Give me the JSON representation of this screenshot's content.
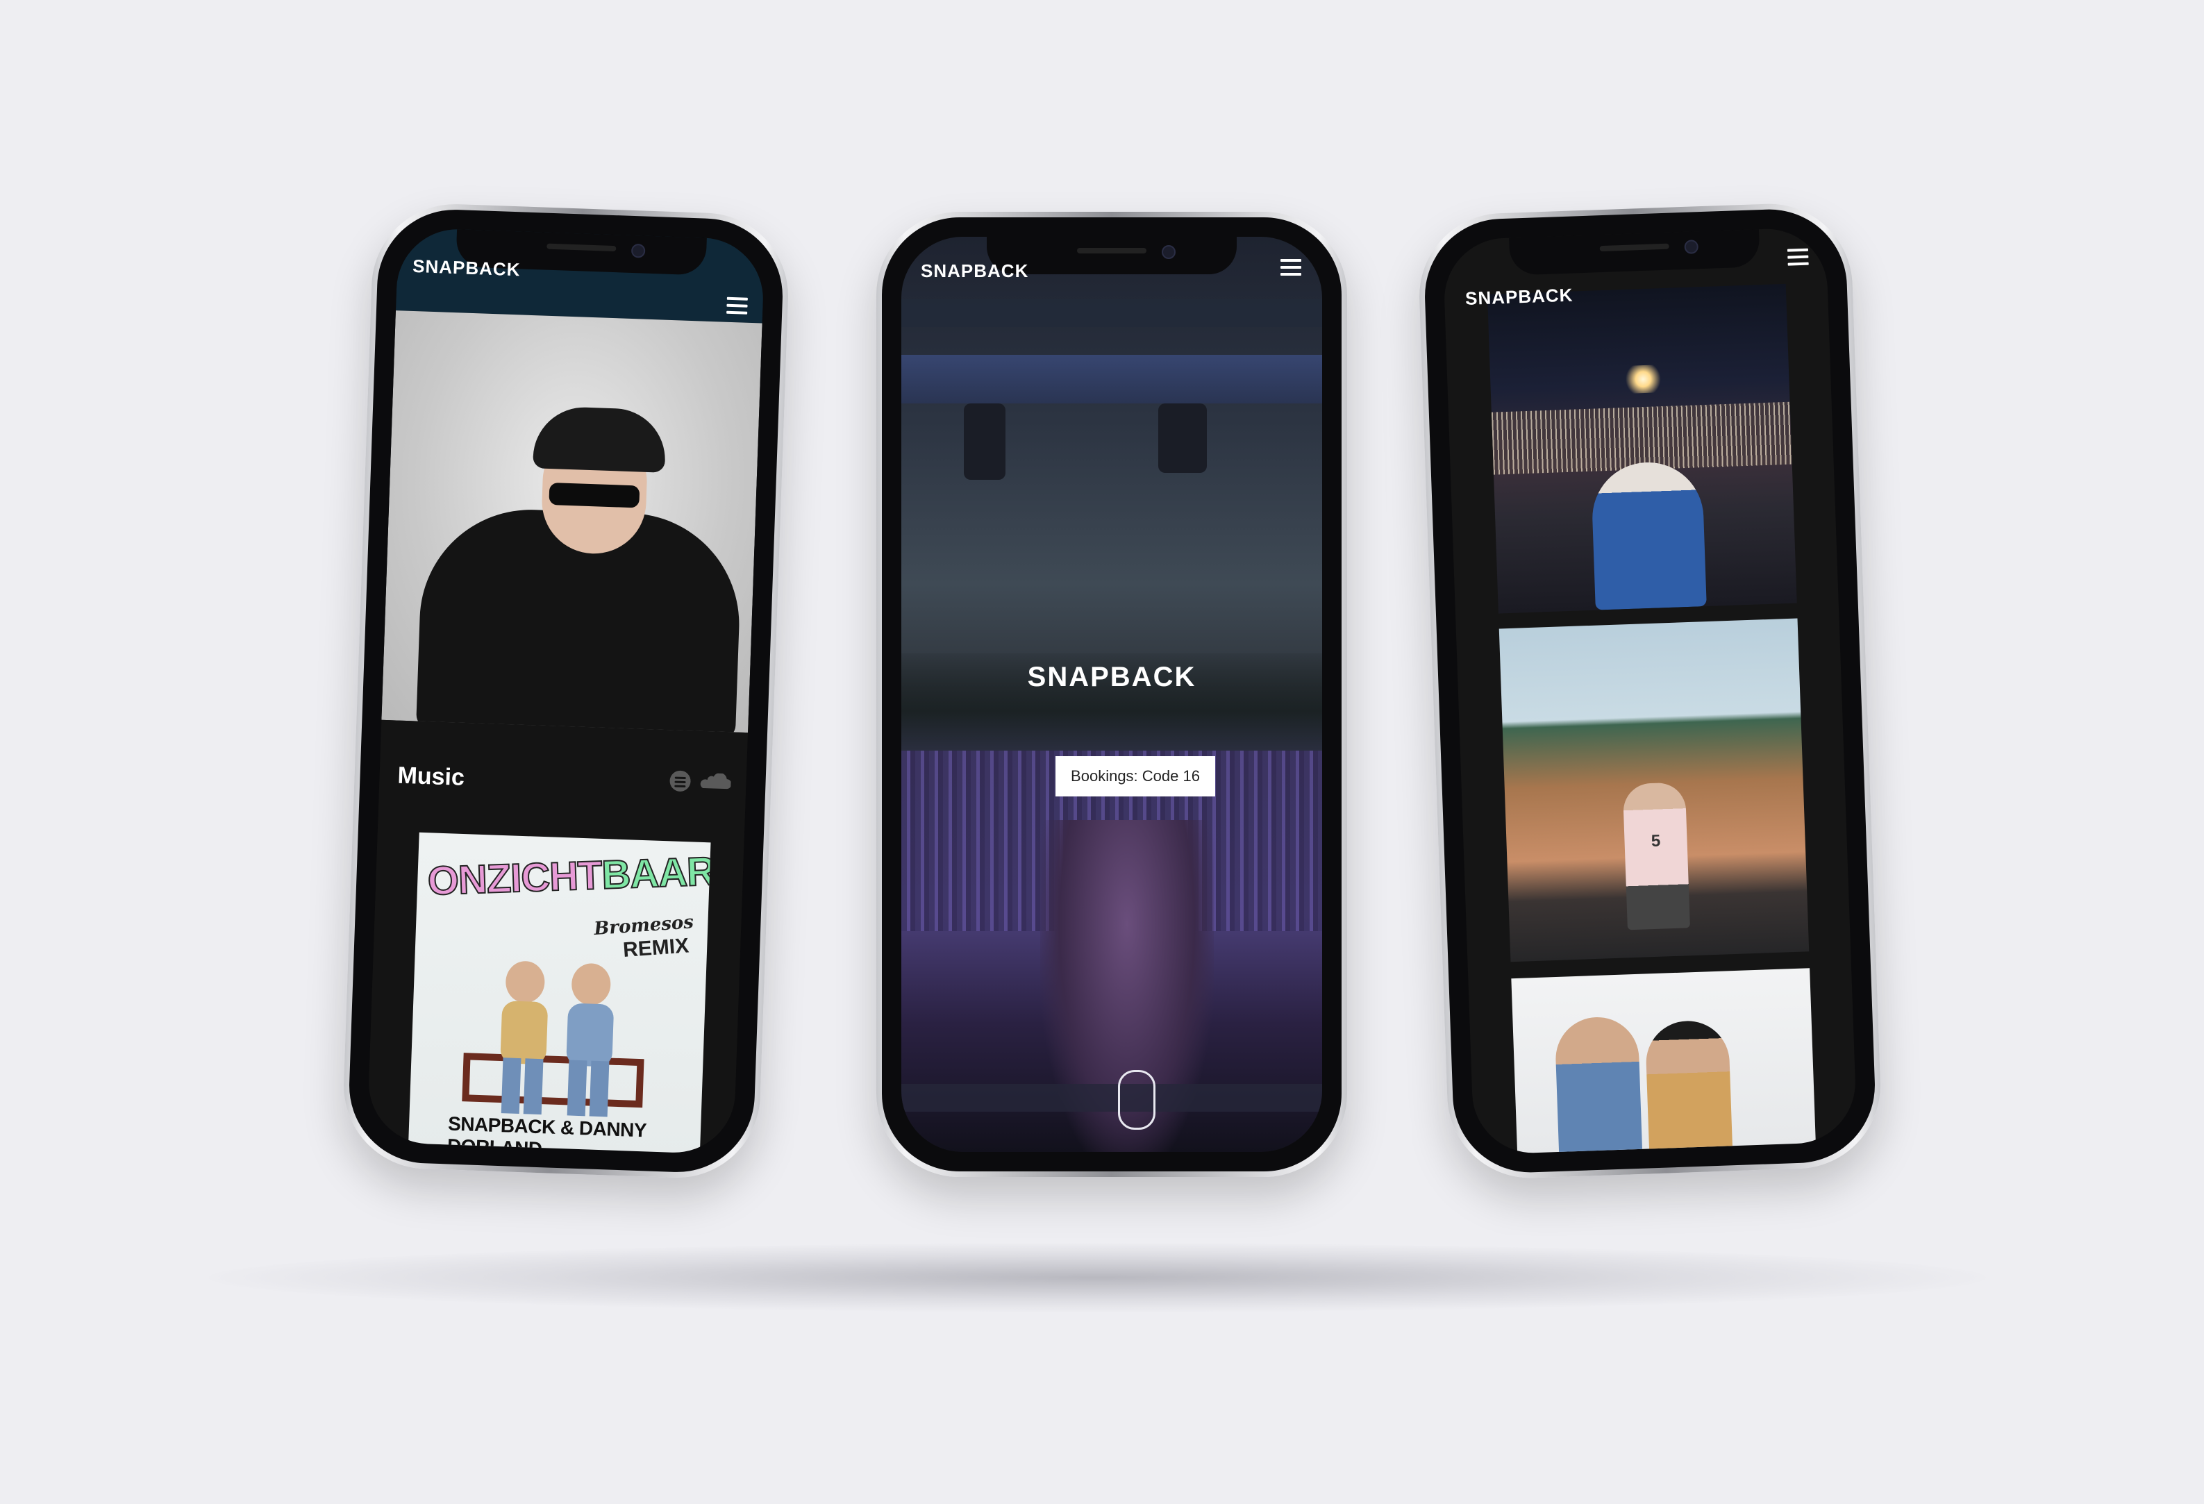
{
  "phones": {
    "left": {
      "brand": "SNAPBACK",
      "section_title": "Music",
      "album": {
        "title_part1": "ONZICHT",
        "title_part2": "BAAR",
        "remix_artist": "Bromesos",
        "remix_label": "REMIX",
        "artists": "SNAPBACK & DANNY DORLAND"
      },
      "icons": [
        "menu-icon",
        "spotify-icon",
        "soundcloud-icon"
      ]
    },
    "center": {
      "brand": "SNAPBACK",
      "hero_logo": "SNAPBACK",
      "booking_button": "Bookings: Code 16",
      "icons": [
        "menu-icon",
        "scroll-indicator"
      ]
    },
    "right": {
      "brand": "SNAPBACK",
      "jersey_number": "5",
      "icons": [
        "menu-icon"
      ]
    }
  },
  "colors": {
    "background": "#eeeef2",
    "left_header": "#0f2838",
    "booking_button_bg": "#ffffff",
    "album_pink": "#e79ad6",
    "album_green": "#7fe6a5"
  }
}
